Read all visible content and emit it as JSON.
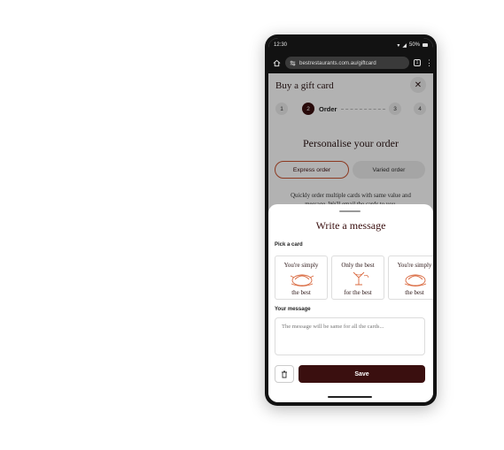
{
  "status": {
    "time": "12:30",
    "battery": "50%"
  },
  "browser": {
    "url": "bestrestaurants.com.au/giftcard",
    "tab_count": "1"
  },
  "gift_card": {
    "title": "Buy a gift card",
    "close": "✕",
    "steps": [
      {
        "number": "1"
      },
      {
        "number": "2",
        "label": "Order"
      },
      {
        "number": "3"
      },
      {
        "number": "4"
      }
    ],
    "heading": "Personalise your order",
    "options": [
      "Express order",
      "Varied order"
    ],
    "description": "Quickly order multiple cards with same value and message. We'll email the cards to you."
  },
  "sheet": {
    "title": "Write a message",
    "pick_label": "Pick a card",
    "cards": [
      {
        "line1": "You're simply",
        "line2": "the best"
      },
      {
        "line1": "Only the best",
        "line2": "for the best"
      },
      {
        "line1": "You're simply",
        "line2": "the best"
      }
    ],
    "message_label": "Your message",
    "message_placeholder": "The message will be same for all the cards...",
    "save_label": "Save"
  },
  "colors": {
    "accent": "#3a0f0f",
    "highlight": "#c9522f"
  }
}
